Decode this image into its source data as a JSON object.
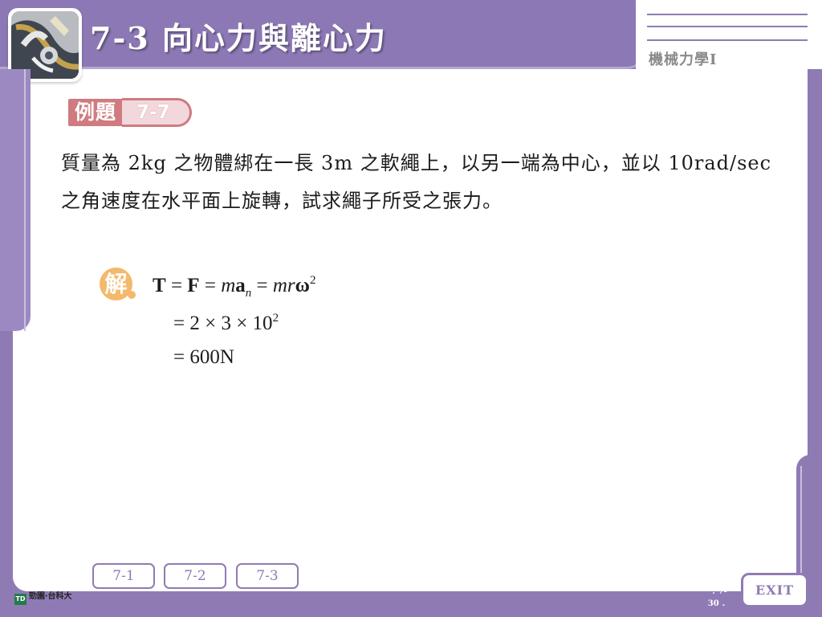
{
  "header": {
    "title": "7-3 向心力與離心力",
    "subtitle": "機械力學I"
  },
  "example": {
    "label": "例題",
    "number": "7-7"
  },
  "problem": {
    "text": "質量為 2kg 之物體綁在一長 3m 之軟繩上，以另一端為中心，並以 10rad/sec 之角速度在水平面上旋轉，試求繩子所受之張力。"
  },
  "solution": {
    "badge": "解",
    "line1": {
      "t": "T",
      "eq1": " = ",
      "f": "F",
      "eq2": " = ",
      "m": "m",
      "a": "a",
      "subscript": "n",
      "eq3": " = ",
      "mr": "mr",
      "omega": "ω",
      "superscript": "2"
    },
    "line2": {
      "prefix": "= 2 × 3 × 10",
      "superscript": "2"
    },
    "line3": "= 600N"
  },
  "navigation": {
    "items": [
      "7-1",
      "7-2",
      "7-3"
    ]
  },
  "footer": {
    "publisher_mark": "TD",
    "publisher": "勁園‧台科大",
    "page": "7-30",
    "exit": "EXIT"
  },
  "colors": {
    "frame": "#8f7bb4",
    "example": "#cf7b7f",
    "solution_badge": "#f4b96b"
  },
  "icons": {
    "header_image": "machine-photo-icon",
    "exit": "exit-button"
  }
}
